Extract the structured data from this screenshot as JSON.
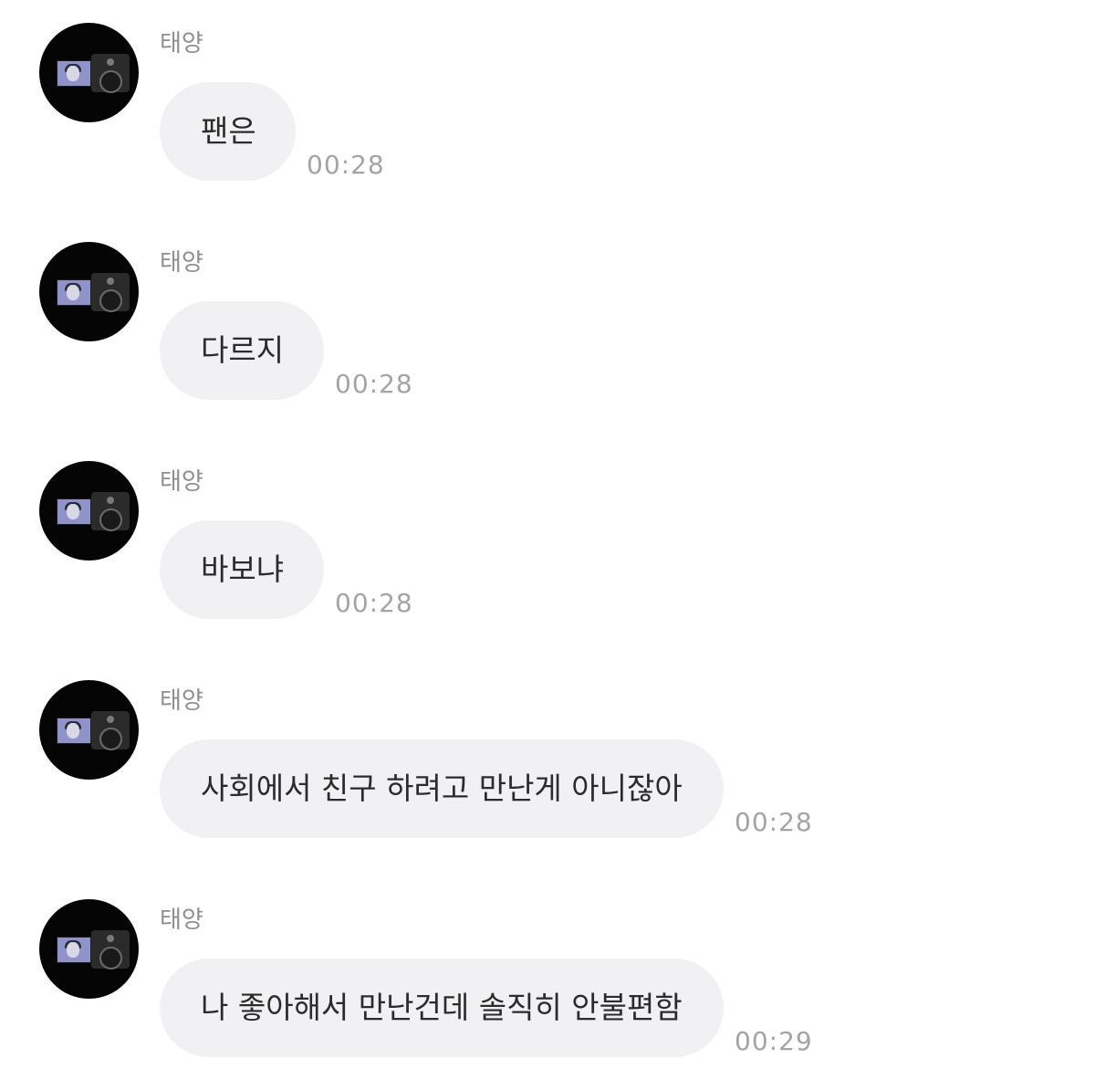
{
  "messages": [
    {
      "sender": "태양",
      "text": "팬은",
      "time": "00:28"
    },
    {
      "sender": "태양",
      "text": "다르지",
      "time": "00:28"
    },
    {
      "sender": "태양",
      "text": "바보냐",
      "time": "00:28"
    },
    {
      "sender": "태양",
      "text": "사회에서 친구 하려고 만난게 아니잖아",
      "time": "00:28"
    },
    {
      "sender": "태양",
      "text": "나 좋아해서 만난건데 솔직히 안불편함",
      "time": "00:29"
    }
  ],
  "icons": {
    "avatar": "profile-photo-camera-screen"
  },
  "colors": {
    "background": "#ffffff",
    "bubble": "#f1f1f4",
    "message_text": "#2b2b2b",
    "sender_name": "#8e8e93",
    "timestamp": "#a3a3a8"
  }
}
